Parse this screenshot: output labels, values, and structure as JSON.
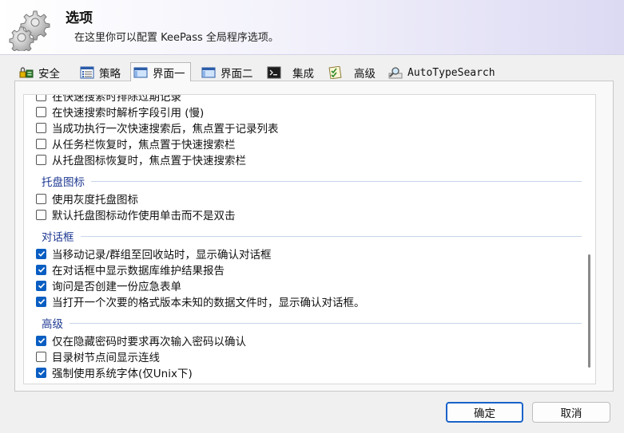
{
  "header": {
    "title": "选项",
    "subtitle": "在这里你可以配置 KeePass 全局程序选项。"
  },
  "tabs": [
    {
      "label": "安全",
      "icon": "security-icon"
    },
    {
      "label": "策略",
      "icon": "policy-list-icon"
    },
    {
      "label": "界面一",
      "icon": "window-icon",
      "active": true
    },
    {
      "label": "界面二",
      "icon": "window-icon"
    },
    {
      "label": "集成",
      "icon": "console-icon"
    },
    {
      "label": "高级",
      "icon": "checklist-icon"
    },
    {
      "label": "AutoTypeSearch",
      "icon": "magnifier-icon"
    }
  ],
  "options": {
    "top_items": [
      {
        "label": "在快速搜索时排除过期记录",
        "checked": false
      },
      {
        "label": "在快速搜索时解析字段引用 (慢)",
        "checked": false
      },
      {
        "label": "当成功执行一次快速搜索后，焦点置于记录列表",
        "checked": false
      },
      {
        "label": "从任务栏恢复时，焦点置于快速搜索栏",
        "checked": false
      },
      {
        "label": "从托盘图标恢复时，焦点置于快速搜索栏",
        "checked": false
      }
    ],
    "groups": [
      {
        "title": "托盘图标",
        "items": [
          {
            "label": "使用灰度托盘图标",
            "checked": false
          },
          {
            "label": "默认托盘图标动作使用单击而不是双击",
            "checked": false
          }
        ]
      },
      {
        "title": "对话框",
        "items": [
          {
            "label": "当移动记录/群组至回收站时，显示确认对话框",
            "checked": true
          },
          {
            "label": "在对话框中显示数据库维护结果报告",
            "checked": true
          },
          {
            "label": "询问是否创建一份应急表单",
            "checked": true
          },
          {
            "label": "当打开一个次要的格式版本未知的数据文件时，显示确认对话框。",
            "checked": true
          }
        ]
      },
      {
        "title": "高级",
        "items": [
          {
            "label": "仅在隐藏密码时要求再次输入密码以确认",
            "checked": true
          },
          {
            "label": "目录树节点间显示连线",
            "checked": false
          },
          {
            "label": "强制使用系统字体(仅Unix下)",
            "checked": true
          }
        ]
      }
    ]
  },
  "buttons": {
    "ok": "确定",
    "cancel": "取消"
  },
  "colors": {
    "accent": "#0a5ec2",
    "group_title": "#1f3a93"
  }
}
